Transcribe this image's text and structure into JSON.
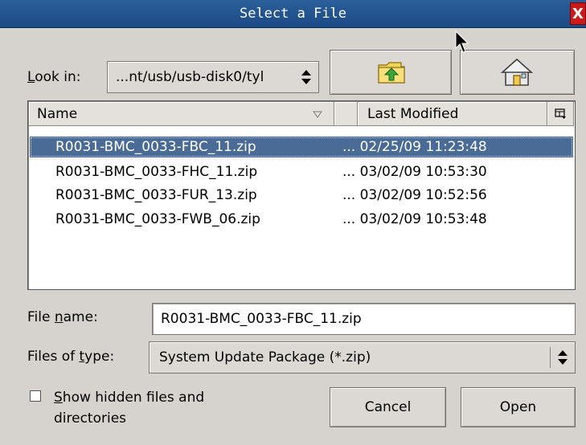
{
  "window": {
    "title": "Select a File",
    "close_label": "X"
  },
  "look_in": {
    "label_prefix": "L",
    "label_rest": "ook in:",
    "value": "...nt/usb/usb-disk0/tyl"
  },
  "icons": {
    "up_folder": "folder-up-icon",
    "home": "home-icon",
    "sort": "sort-indicator-icon",
    "column_menu": "column-menu-icon"
  },
  "columns": {
    "name": "Name",
    "modified": "Last Modified"
  },
  "files": [
    {
      "name": "R0031-BMC_0033-FBC_11.zip",
      "modified": "... 02/25/09 11:23:48",
      "selected": true
    },
    {
      "name": "R0031-BMC_0033-FHC_11.zip",
      "modified": "... 03/02/09 10:53:30",
      "selected": false
    },
    {
      "name": "R0031-BMC_0033-FUR_13.zip",
      "modified": "... 03/02/09 10:52:56",
      "selected": false
    },
    {
      "name": "R0031-BMC_0033-FWB_06.zip",
      "modified": "... 03/02/09 10:53:48",
      "selected": false
    }
  ],
  "file_name": {
    "label_pre": "File ",
    "label_ul": "n",
    "label_post": "ame:",
    "value": "R0031-BMC_0033-FBC_11.zip"
  },
  "file_type": {
    "label_pre": "Files of ",
    "label_ul": "t",
    "label_post": "ype:",
    "value": "System Update Package (*.zip)"
  },
  "show_hidden": {
    "label_ul": "S",
    "label_line1": "how hidden files and",
    "label_line2": "directories",
    "checked": false
  },
  "buttons": {
    "cancel": "Cancel",
    "open": "Open"
  }
}
